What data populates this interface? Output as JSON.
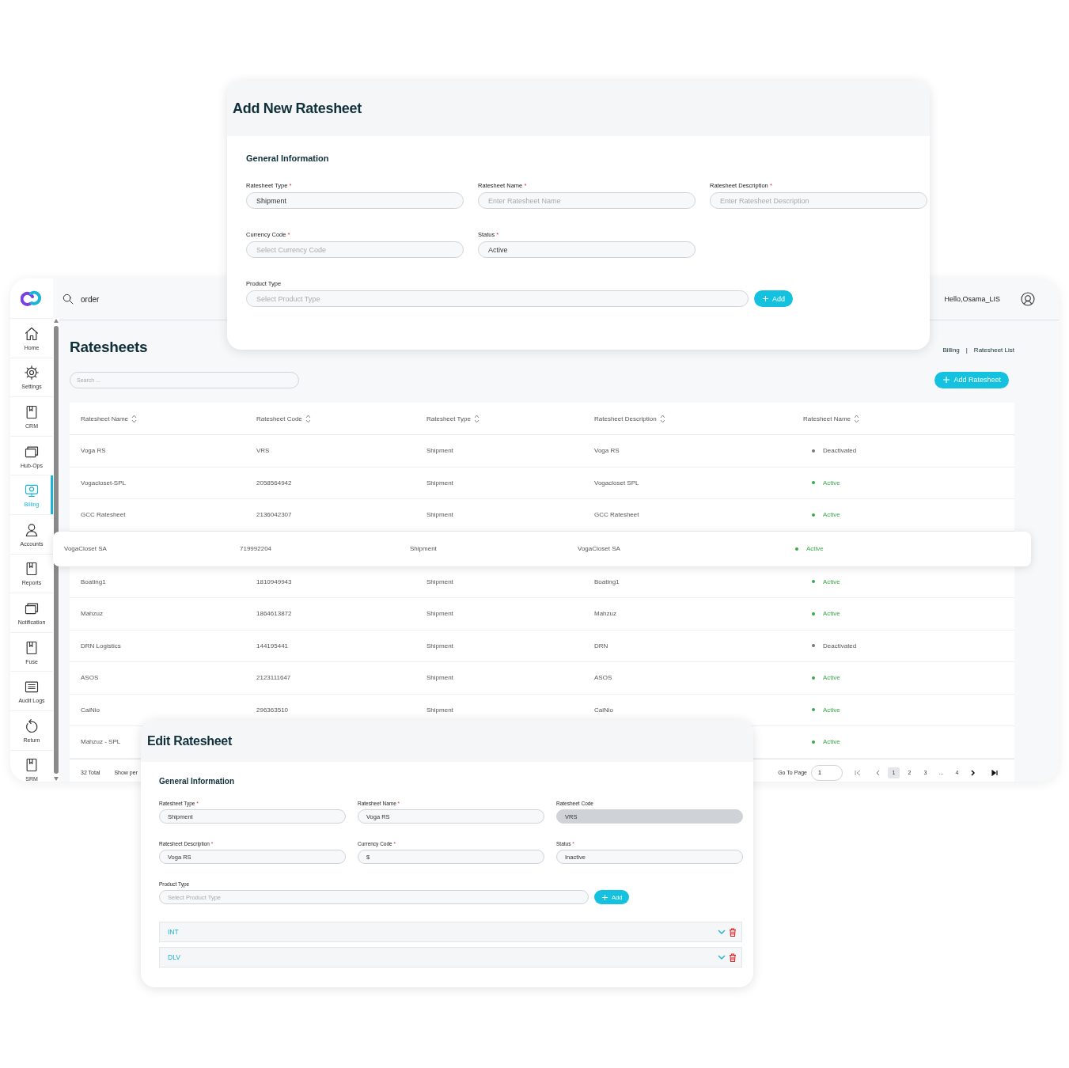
{
  "app": {
    "sidebar": {
      "items": [
        {
          "label": "Home",
          "selected": false
        },
        {
          "label": "Settings",
          "selected": false
        },
        {
          "label": "CRM",
          "selected": false
        },
        {
          "label": "Hub-Ops",
          "selected": false
        },
        {
          "label": "Billing",
          "selected": true
        },
        {
          "label": "Accounts",
          "selected": false
        },
        {
          "label": "Reports",
          "selected": false
        },
        {
          "label": "Notification",
          "selected": false
        },
        {
          "label": "Fuse",
          "selected": false
        },
        {
          "label": "Audit Logs",
          "selected": false
        },
        {
          "label": "Return",
          "selected": false
        },
        {
          "label": "SRM",
          "selected": false
        }
      ]
    },
    "header": {
      "search_value": "order",
      "greeting": "Hello,Osama_LIS"
    },
    "page_title": "Ratesheets",
    "breadcrumb": {
      "items": [
        "Billing",
        "Ratesheet List"
      ],
      "separator": "|"
    },
    "search": {
      "placeholder": "Search ..."
    },
    "add_button": "Add Ratesheet",
    "table": {
      "columns": [
        "Ratesheet Name",
        "Ratesheet Code",
        "Ratesheet Type",
        "Ratesheet Description",
        "Ratesheet Name"
      ],
      "rows": [
        {
          "name": "Voga RS",
          "code": "VRS",
          "type": "Shipment",
          "description": "Voga RS",
          "status": "Deactivated",
          "active": false,
          "highlighted": false
        },
        {
          "name": "Vogacloset-SPL",
          "code": "2058564942",
          "type": "Shipment",
          "description": "Vogacloset SPL",
          "status": "Active",
          "active": true,
          "highlighted": false
        },
        {
          "name": "GCC Ratesheet",
          "code": "2136042307",
          "type": "Shipment",
          "description": "GCC Ratesheet",
          "status": "Active",
          "active": true,
          "highlighted": false
        },
        {
          "name": "VogaCloset SA",
          "code": "719992204",
          "type": "Shipment",
          "description": "VogaCloset SA",
          "status": "Active",
          "active": true,
          "highlighted": true
        },
        {
          "name": "Boating1",
          "code": "1810949943",
          "type": "Shipment",
          "description": "Boating1",
          "status": "Active",
          "active": true,
          "highlighted": false
        },
        {
          "name": "Mahzuz",
          "code": "1864613872",
          "type": "Shipment",
          "description": "Mahzuz",
          "status": "Active",
          "active": true,
          "highlighted": false
        },
        {
          "name": "DRN Logistics",
          "code": "144195441",
          "type": "Shipment",
          "description": "DRN",
          "status": "Deactivated",
          "active": false,
          "highlighted": false
        },
        {
          "name": "ASOS",
          "code": "2123111647",
          "type": "Shipment",
          "description": "ASOS",
          "status": "Active",
          "active": true,
          "highlighted": false
        },
        {
          "name": "CaiNio",
          "code": "296363510",
          "type": "Shipment",
          "description": "CaiNio",
          "status": "Active",
          "active": true,
          "highlighted": false
        },
        {
          "name": "Mahzuz - SPL",
          "status": "Active",
          "active": true,
          "highlighted": false
        }
      ]
    },
    "footer": {
      "total": "32 Total",
      "show_per": "Show per",
      "go_to_page": "Go To Page",
      "page_value": "1",
      "pages": [
        {
          "label": "1",
          "selected": true
        },
        {
          "label": "2",
          "selected": false
        },
        {
          "label": "3",
          "selected": false
        },
        {
          "label": "...",
          "selected": false
        },
        {
          "label": "4",
          "selected": false
        }
      ]
    }
  },
  "add_modal": {
    "title": "Add New Ratesheet",
    "section": "General Information",
    "fields": [
      {
        "label": "Ratesheet Type",
        "required_mark": "*",
        "value": "Shipment",
        "disabled": false
      },
      {
        "label": "Ratesheet Name",
        "required_mark": "*",
        "placeholder": "Enter Ratesheet Name",
        "disabled": false
      },
      {
        "label": "Ratesheet Description",
        "required_mark": "*",
        "placeholder": "Enter Ratesheet Description",
        "disabled": false
      },
      {
        "label": "Currency Code",
        "required_mark": "*",
        "placeholder": "Select Currency Code",
        "disabled": false
      },
      {
        "label": "Status",
        "required_mark": "*",
        "value": "Active",
        "disabled": false
      }
    ],
    "product_type": {
      "label": "Product Type",
      "placeholder": "Select Product Type"
    },
    "add_button": "Add"
  },
  "edit_modal": {
    "title": "Edit Ratesheet",
    "section": "General Information",
    "fields": [
      {
        "label": "Ratesheet Type",
        "required_mark": "*",
        "value": "Shipment",
        "disabled": false
      },
      {
        "label": "Ratesheet Name",
        "required_mark": "*",
        "value": "Voga RS",
        "disabled": false
      },
      {
        "label": "Ratesheet Code",
        "value": "VRS",
        "disabled": true
      },
      {
        "label": "Ratesheet Description",
        "required_mark": "*",
        "value": "Voga RS",
        "disabled": false
      },
      {
        "label": "Currency Code",
        "required_mark": "*",
        "value": "$",
        "disabled": false
      },
      {
        "label": "Status",
        "required_mark": "*",
        "value": "Inactive",
        "disabled": false
      }
    ],
    "product_type": {
      "label": "Product Type",
      "placeholder": "Select Product Type"
    },
    "add_button": "Add",
    "products": [
      {
        "label": "INT",
        "expanded": false
      },
      {
        "label": "DLV",
        "expanded": false
      }
    ]
  }
}
